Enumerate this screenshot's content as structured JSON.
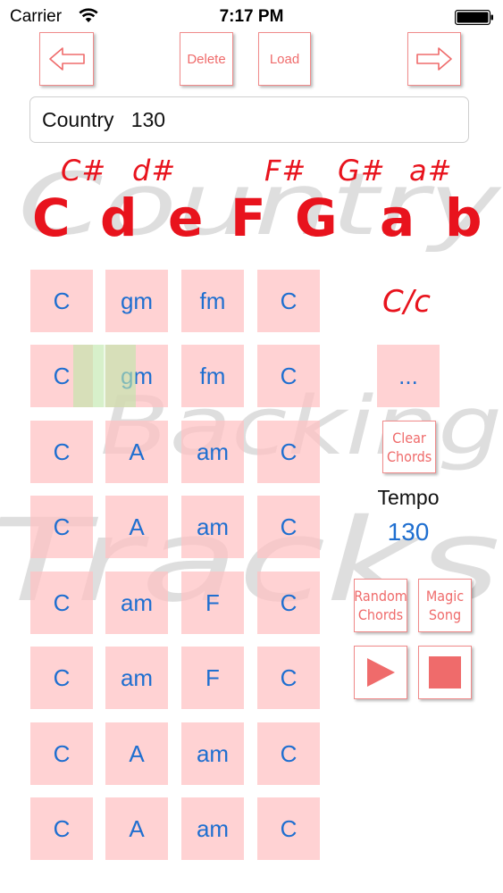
{
  "status_bar": {
    "carrier": "Carrier",
    "time": "7:17 PM"
  },
  "toolbar": {
    "prev_icon": "left-arrow-icon",
    "delete_label": "Delete",
    "load_label": "Load",
    "next_icon": "right-arrow-icon"
  },
  "song": {
    "name": "Country   130"
  },
  "key_selector": {
    "sharps": [
      "C#",
      "d#",
      "F#",
      "G#",
      "a#"
    ],
    "notes": [
      "C",
      "d",
      "e",
      "F",
      "G",
      "a",
      "b"
    ]
  },
  "chord_grid": {
    "rows": [
      [
        "C",
        "gm",
        "fm",
        "C"
      ],
      [
        "C",
        "gm",
        "fm",
        "C"
      ],
      [
        "C",
        "A",
        "am",
        "C"
      ],
      [
        "C",
        "A",
        "am",
        "C"
      ],
      [
        "C",
        "am",
        "F",
        "C"
      ],
      [
        "C",
        "am",
        "F",
        "C"
      ],
      [
        "C",
        "A",
        "am",
        "C"
      ],
      [
        "C",
        "A",
        "am",
        "C"
      ]
    ],
    "playing_row": 2
  },
  "panel": {
    "current_chord": "C/c",
    "more_label": "...",
    "clear_chords_label": "Clear Chords",
    "tempo_label": "Tempo",
    "tempo_value": "130",
    "random_chords_label": "Random Chords",
    "magic_song_label": "Magic Song",
    "play_icon": "play-icon",
    "stop_icon": "stop-icon"
  },
  "colors": {
    "accent_red": "#e8131d",
    "button_text": "#ef6b6b",
    "cell_fill": "#ffc0c2",
    "chord_text": "#1f6fd0",
    "highlight": "#bee6aa"
  },
  "watermark": {
    "lines": [
      "Country",
      "Backing",
      "Tracks"
    ]
  }
}
